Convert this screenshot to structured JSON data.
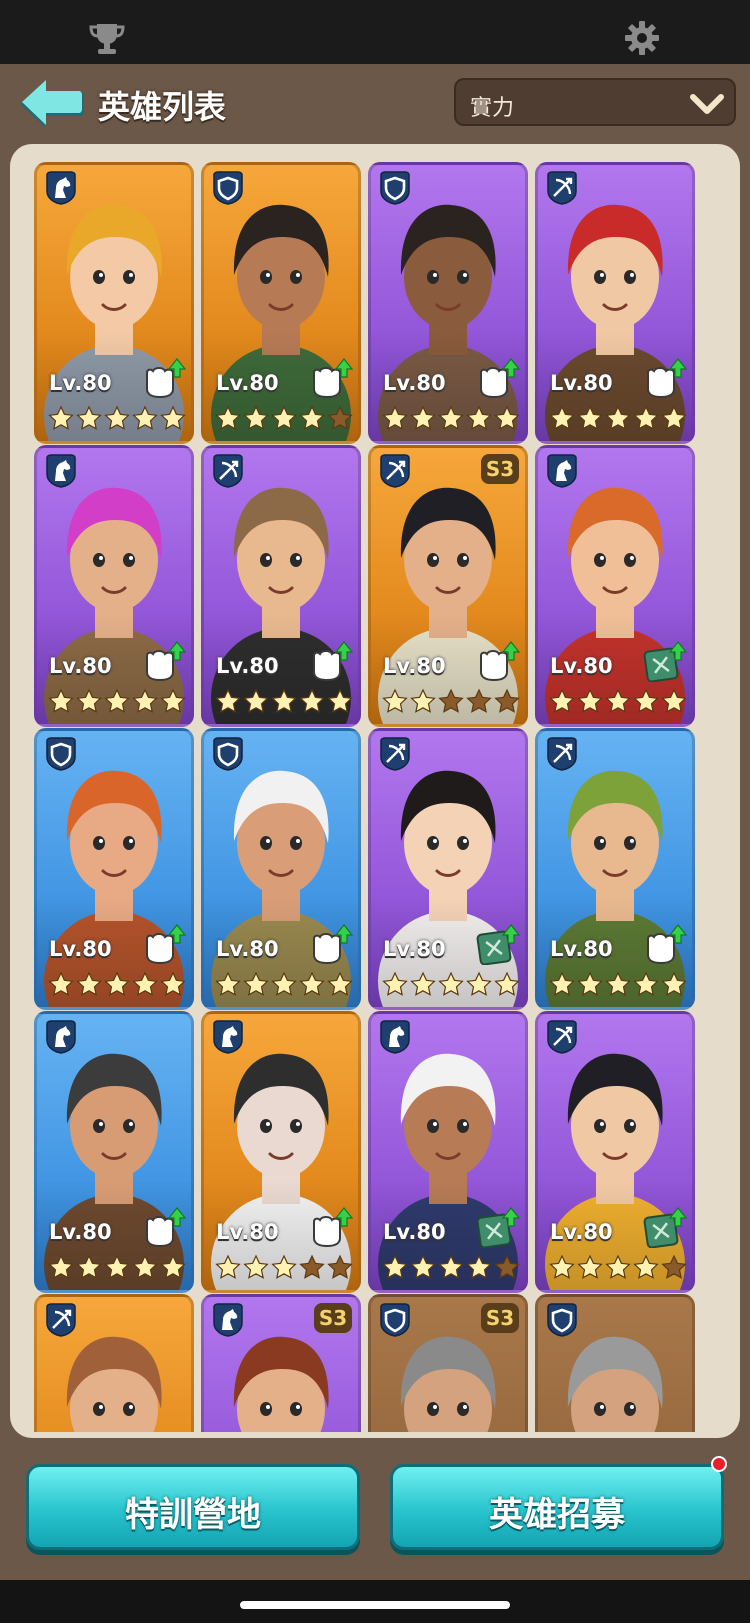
{
  "header": {
    "title": "英雄列表",
    "sort_value": "實力"
  },
  "heroes": [
    {
      "color": "orange",
      "class_icon": "horse-icon",
      "level": "Lv.80",
      "stars": 5,
      "upgrade": "bonus-upgrade-icon",
      "season": "",
      "hair": "#e9a82a",
      "skin": "#f3c9a6",
      "outfit": "#8f9aa8"
    },
    {
      "color": "orange",
      "class_icon": "shield-icon",
      "level": "Lv.80",
      "stars": 4,
      "upgrade": "bonus-upgrade-icon",
      "season": "",
      "hair": "#2a2320",
      "skin": "#b67a55",
      "outfit": "#3f6b3a"
    },
    {
      "color": "purple",
      "class_icon": "shield-icon",
      "level": "Lv.80",
      "stars": 5,
      "upgrade": "bonus-upgrade-icon",
      "season": "",
      "hair": "#2a2320",
      "skin": "#8a5b3c",
      "outfit": "#7a5a45"
    },
    {
      "color": "purple",
      "class_icon": "crossbow-icon",
      "level": "Lv.80",
      "stars": 5,
      "upgrade": "bonus-upgrade-icon",
      "season": "",
      "hair": "#c92a2a",
      "skin": "#f1c8a4",
      "outfit": "#6b4a2e"
    },
    {
      "color": "purple",
      "class_icon": "horse-icon",
      "level": "Lv.80",
      "stars": 5,
      "upgrade": "bonus-upgrade-icon",
      "season": "",
      "hair": "#d23ec8",
      "skin": "#e4b08a",
      "outfit": "#8d6b46"
    },
    {
      "color": "purple",
      "class_icon": "crossbow-icon",
      "level": "Lv.80",
      "stars": 5,
      "upgrade": "bonus-upgrade-icon",
      "season": "",
      "hair": "#8c6a48",
      "skin": "#e8b98f",
      "outfit": "#2e2e2e"
    },
    {
      "color": "orange",
      "class_icon": "crossbow-icon",
      "level": "Lv.80",
      "stars": 2,
      "upgrade": "bonus-upgrade-icon",
      "season": "3",
      "hair": "#1f1f25",
      "skin": "#e4b08a",
      "outfit": "#e7e1c8"
    },
    {
      "color": "purple",
      "class_icon": "horse-icon",
      "level": "Lv.80",
      "stars": 5,
      "upgrade": "book-upgrade-icon",
      "season": "",
      "hair": "#d96a2a",
      "skin": "#f0bf98",
      "outfit": "#c4332c"
    },
    {
      "color": "blue",
      "class_icon": "shield-icon",
      "level": "Lv.80",
      "stars": 5,
      "upgrade": "bonus-upgrade-icon",
      "season": "",
      "hair": "#d9652a",
      "skin": "#e8a985",
      "outfit": "#b5542c"
    },
    {
      "color": "blue",
      "class_icon": "shield-icon",
      "level": "Lv.80",
      "stars": 5,
      "upgrade": "bonus-upgrade-icon",
      "season": "",
      "hair": "#f1f1f1",
      "skin": "#d99e78",
      "outfit": "#9a8a50"
    },
    {
      "color": "purple",
      "class_icon": "crossbow-icon",
      "level": "Lv.80",
      "stars": 4.5,
      "upgrade": "book-upgrade-icon",
      "season": "",
      "hair": "#1f1b1b",
      "skin": "#f4d2b6",
      "outfit": "#f2eeee"
    },
    {
      "color": "blue",
      "class_icon": "crossbow-icon",
      "level": "Lv.80",
      "stars": 5,
      "upgrade": "bonus-upgrade-icon",
      "season": "",
      "hair": "#7da23a",
      "skin": "#e8b98f",
      "outfit": "#5c7a35"
    },
    {
      "color": "blue",
      "class_icon": "horse-icon",
      "level": "Lv.80",
      "stars": 5,
      "upgrade": "bonus-upgrade-icon",
      "season": "",
      "hair": "#3c3c3c",
      "skin": "#d89c74",
      "outfit": "#6e4a30"
    },
    {
      "color": "orange",
      "class_icon": "horse-icon",
      "level": "Lv.80",
      "stars": 2.5,
      "upgrade": "bonus-upgrade-icon",
      "season": "",
      "hair": "#2e2e2e",
      "skin": "#e9d9d0",
      "outfit": "#f2f2f2"
    },
    {
      "color": "purple",
      "class_icon": "horse-icon",
      "level": "Lv.80",
      "stars": 4,
      "upgrade": "book-upgrade-icon",
      "season": "",
      "hair": "#f2f2f2",
      "skin": "#b77b56",
      "outfit": "#2f3b6e"
    },
    {
      "color": "purple",
      "class_icon": "crossbow-icon",
      "level": "Lv.80",
      "stars": 4,
      "upgrade": "book-upgrade-icon",
      "season": "",
      "hair": "#1f1f25",
      "skin": "#f1c8a4",
      "outfit": "#f0b030"
    },
    {
      "color": "orange",
      "class_icon": "crossbow-icon",
      "level": "",
      "stars": 0,
      "upgrade": "",
      "season": "",
      "hair": "#a0613a",
      "skin": "#e4b08a",
      "outfit": "#2f7fb0"
    },
    {
      "color": "purple",
      "class_icon": "horse-icon",
      "level": "",
      "stars": 0,
      "upgrade": "",
      "season": "3",
      "hair": "#8a3a20",
      "skin": "#e4b08a",
      "outfit": "#3a2a58"
    },
    {
      "color": "brown",
      "class_icon": "shield-icon",
      "level": "",
      "stars": 0,
      "upgrade": "",
      "season": "3",
      "hair": "#8a8a8a",
      "skin": "#d4a27e",
      "outfit": "#6e4a30"
    },
    {
      "color": "brown",
      "class_icon": "shield-icon",
      "level": "",
      "stars": 0,
      "upgrade": "",
      "season": "",
      "hair": "#9a9a9a",
      "skin": "#d4a27e",
      "outfit": "#4e3a2a"
    }
  ],
  "buttons": {
    "training": "特訓營地",
    "recruit": "英雄招募"
  },
  "colors": {
    "orange": "#e38a1e",
    "purple": "#9357d9",
    "blue": "#4296e3",
    "accent_button": "#28c4cd",
    "notif": "#e8202c"
  }
}
